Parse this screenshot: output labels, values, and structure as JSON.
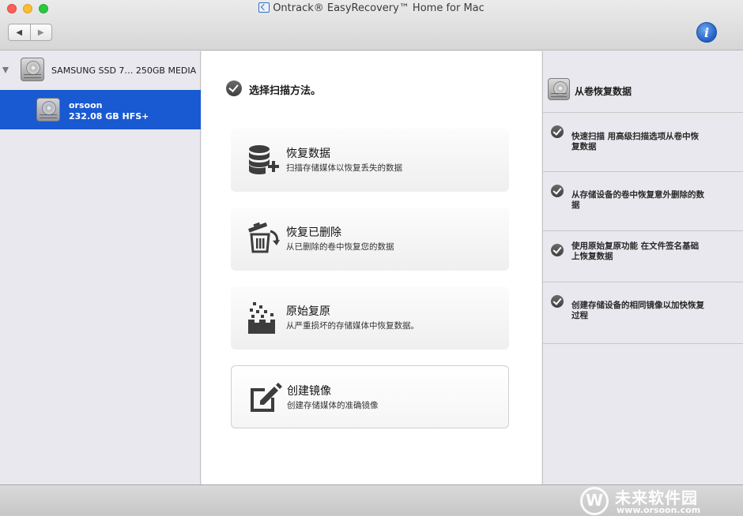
{
  "window": {
    "title": "Ontrack® EasyRecovery™ Home for Mac"
  },
  "toolbar": {
    "back_label": "◀",
    "forward_label": "▶",
    "info_label": "i"
  },
  "sidebar": {
    "disk": {
      "label": "SAMSUNG SSD 7… 250GB MEDIA"
    },
    "volume": {
      "name": "orsoon",
      "size": "232.08 GB HFS+"
    }
  },
  "main": {
    "heading": "选择扫描方法。",
    "options": [
      {
        "title": "恢复数据",
        "desc": "扫描存储媒体以恢复丢失的数据",
        "icon": "database-add-icon"
      },
      {
        "title": "恢复已删除",
        "desc": "从已删除的卷中恢复您的数据",
        "icon": "trash-restore-icon"
      },
      {
        "title": "原始复原",
        "desc": "从严重损坏的存储媒体中恢复数据。",
        "icon": "raw-blocks-icon"
      },
      {
        "title": "创建镜像",
        "desc": "创建存储媒体的准确镜像",
        "icon": "edit-image-icon"
      }
    ]
  },
  "rightpanel": {
    "title": "从卷恢复数据",
    "items": [
      "快速扫描 用高级扫描选项从卷中恢复数据",
      "从存储设备的卷中恢复意外删除的数据",
      "使用原始复原功能 在文件签名基础上恢复数据",
      "创建存储设备的相同镜像以加快恢复过程"
    ]
  },
  "watermark": {
    "cn": "未来软件园",
    "url": "www.orsoon.com"
  },
  "colors": {
    "selection": "#1959d1",
    "traffic_close": "#fc5f57",
    "traffic_min": "#fdbd2e",
    "traffic_max": "#28c940",
    "info_button": "#1f5fc4"
  }
}
